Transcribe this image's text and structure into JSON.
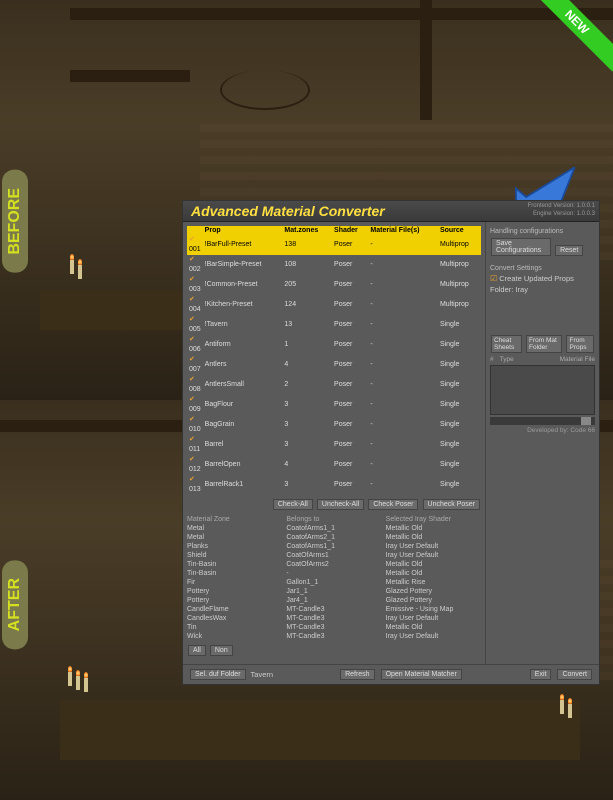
{
  "labels": {
    "before": "BEFORE",
    "after": "AFTER",
    "new": "NEW"
  },
  "dialog": {
    "title": "Advanced Material Converter",
    "version": {
      "frontend": "Frontend Version: 1.0.0.1",
      "engine": "Engine Version: 1.0.0.3"
    },
    "columns": {
      "prop": "Prop",
      "mat_zones": "Mat.zones",
      "shader": "Shader",
      "material_files": "Material File(s)",
      "source": "Source"
    },
    "rows": [
      {
        "id": "001",
        "prop": "!BarFull-Preset",
        "mz": "138",
        "shader": "Poser",
        "mf": "-",
        "src": "Multiprop",
        "sel": true
      },
      {
        "id": "002",
        "prop": "!BarSimple-Preset",
        "mz": "108",
        "shader": "Poser",
        "mf": "-",
        "src": "Multiprop"
      },
      {
        "id": "003",
        "prop": "!Common-Preset",
        "mz": "205",
        "shader": "Poser",
        "mf": "-",
        "src": "Multiprop"
      },
      {
        "id": "004",
        "prop": "!Kitchen-Preset",
        "mz": "124",
        "shader": "Poser",
        "mf": "-",
        "src": "Multiprop"
      },
      {
        "id": "005",
        "prop": "!Tavern",
        "mz": "13",
        "shader": "Poser",
        "mf": "-",
        "src": "Single"
      },
      {
        "id": "006",
        "prop": "Antiform",
        "mz": "1",
        "shader": "Poser",
        "mf": "-",
        "src": "Single"
      },
      {
        "id": "007",
        "prop": "Antlers",
        "mz": "4",
        "shader": "Poser",
        "mf": "-",
        "src": "Single"
      },
      {
        "id": "008",
        "prop": "AntlersSmall",
        "mz": "2",
        "shader": "Poser",
        "mf": "-",
        "src": "Single"
      },
      {
        "id": "009",
        "prop": "BagFlour",
        "mz": "3",
        "shader": "Poser",
        "mf": "-",
        "src": "Single"
      },
      {
        "id": "010",
        "prop": "BagGrain",
        "mz": "3",
        "shader": "Poser",
        "mf": "-",
        "src": "Single"
      },
      {
        "id": "011",
        "prop": "Barrel",
        "mz": "3",
        "shader": "Poser",
        "mf": "-",
        "src": "Single"
      },
      {
        "id": "012",
        "prop": "BarrelOpen",
        "mz": "4",
        "shader": "Poser",
        "mf": "-",
        "src": "Single"
      },
      {
        "id": "013",
        "prop": "BarrelRack1",
        "mz": "3",
        "shader": "Poser",
        "mf": "-",
        "src": "Single"
      }
    ],
    "buttons": {
      "check_all": "Check-All",
      "uncheck_all": "Uncheck-All",
      "check_poser": "Check Poser",
      "uncheck_poser": "Uncheck Poser",
      "all": "All",
      "non": "Non",
      "refresh": "Refresh",
      "open_mm": "Open Material Matcher",
      "exit": "Exit",
      "convert": "Convert",
      "sel_duf": "Sel. duf Folder",
      "reset": "Reset",
      "save_config": "Save Configurations",
      "cheat_sheets": "Cheat Sheets",
      "from_mat_folder": "From Mat Folder",
      "from_props": "From Props"
    },
    "mat_headers": {
      "zone": "Material Zone",
      "belongs": "Belongs to",
      "selected": "Selected Iray Shader"
    },
    "materials": [
      {
        "zone": "Metal",
        "belongs": "CoatofArms1_1",
        "shader": "Metallic Old"
      },
      {
        "zone": "Metal",
        "belongs": "CoatofArms2_1",
        "shader": "Metallic Old"
      },
      {
        "zone": "Planks",
        "belongs": "CoatofArms1_1",
        "shader": "Iray User Default"
      },
      {
        "zone": "Shield",
        "belongs": "CoatOfArms1",
        "shader": "Iray User Default"
      },
      {
        "zone": "Tin-Basin",
        "belongs": "CoatOfArms2",
        "shader": "Metallic Old"
      },
      {
        "zone": "Tin-Basin",
        "belongs": "-",
        "shader": "Metallic Old"
      },
      {
        "zone": "Fir",
        "belongs": "Gallon1_1",
        "shader": "Metallic Rise"
      },
      {
        "zone": "Pottery",
        "belongs": "Jar1_1",
        "shader": "Glazed Pottery"
      },
      {
        "zone": "Pottery",
        "belongs": "Jar4_1",
        "shader": "Glazed Pottery"
      },
      {
        "zone": "CandleFlame",
        "belongs": "MT-Candle3",
        "shader": "Emissive - Using Map"
      },
      {
        "zone": "CandlesWax",
        "belongs": "MT-Candle3",
        "shader": "Iray User Default"
      },
      {
        "zone": "Tin",
        "belongs": "MT-Candle3",
        "shader": "Metallic Old"
      },
      {
        "zone": "Wick",
        "belongs": "MT-Candle3",
        "shader": "Iray User Default"
      }
    ],
    "right": {
      "handling": "Handling configurations",
      "convert_settings": "Convert Settings",
      "create_updated": "Create Updated Props",
      "folder_label": "Folder:",
      "folder_value": "Iray",
      "type": "Type",
      "material_file": "Material File",
      "hash": "#",
      "developed_by": "Developed by: Code 66"
    },
    "footer_folder": "Tavern"
  }
}
